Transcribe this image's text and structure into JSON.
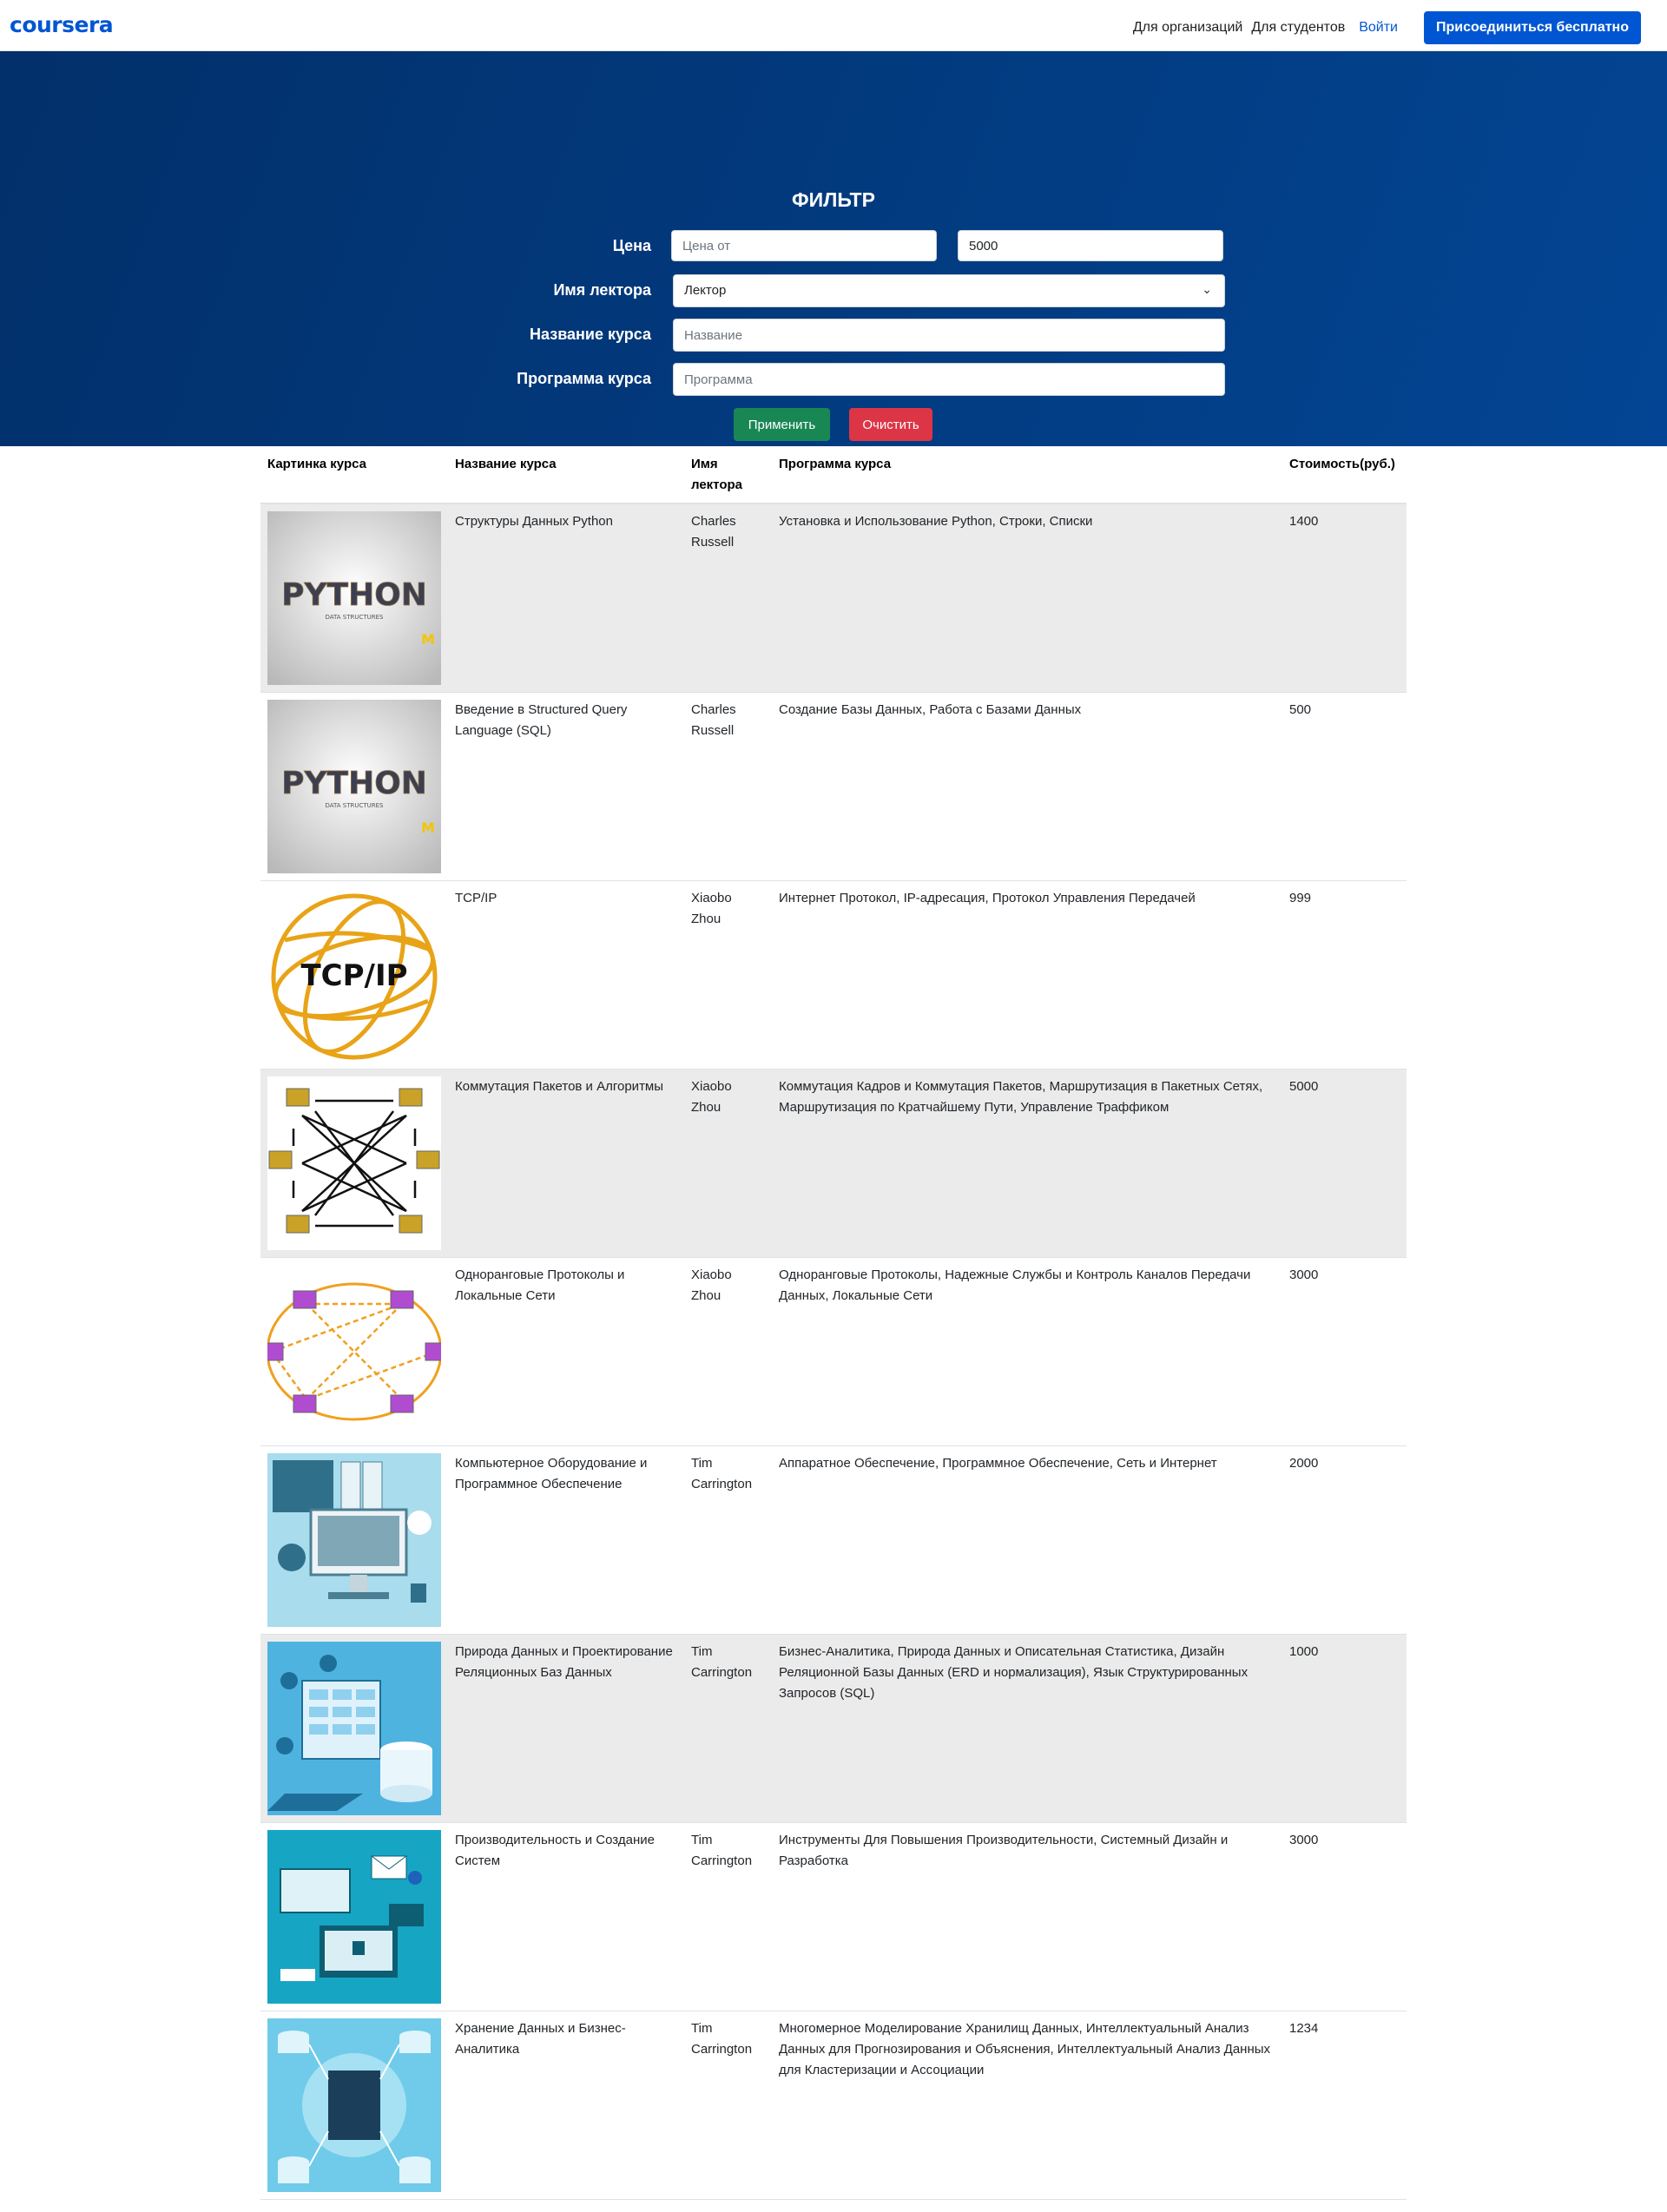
{
  "nav": {
    "logo": "coursera",
    "for_organizations": "Для организаций",
    "for_students": "Для студентов",
    "login": "Войти",
    "join": "Присоединиться бесплатно"
  },
  "filter": {
    "title": "ФИЛЬТР",
    "price_label": "Цена",
    "price_from_placeholder": "Цена от",
    "price_to_value": "5000",
    "lecturer_label": "Имя лектора",
    "lecturer_selected": "Лектор",
    "course_name_label": "Название курса",
    "course_name_placeholder": "Название",
    "program_label": "Программа курса",
    "program_placeholder": "Программа",
    "apply": "Применить",
    "clear": "Очистить"
  },
  "table": {
    "headers": {
      "image": "Картинка курса",
      "name": "Название курса",
      "lecturer": "Имя лектора",
      "program": "Программа курса",
      "price": "Стоимость(руб.)"
    },
    "rows": [
      {
        "image": "python-data-structures-image",
        "name": "Структуры Данных Python",
        "lecturer": "Charles Russell",
        "program": "Установка и Использование Python, Строки, Списки",
        "price": "1400"
      },
      {
        "image": "python-data-structures-image",
        "name": "Введение в Structured Query Language (SQL)",
        "lecturer": "Charles Russell",
        "program": "Создание Базы Данных, Работа с Базами Данных",
        "price": "500"
      },
      {
        "image": "tcp-ip-globe-image",
        "name": "TCP/IP",
        "lecturer": "Xiaobo Zhou",
        "program": "Интернет Протокол, IP-адресация, Протокол Управления Передачей",
        "price": "999"
      },
      {
        "image": "packet-switching-network-image",
        "name": "Коммутация Пакетов и Алгоритмы",
        "lecturer": "Xiaobo Zhou",
        "program": "Коммутация Кадров и Коммутация Пакетов, Маршрутизация в Пакетных Сетях, Маршрутизация по Кратчайшему Пути, Управление Траффиком",
        "price": "5000"
      },
      {
        "image": "p2p-network-image",
        "name": "Одноранговые Протоколы и Локальные Сети",
        "lecturer": "Xiaobo Zhou",
        "program": "Одноранговые Протоколы, Надежные Службы и Контроль Каналов Передачи Данных, Локальные Сети",
        "price": "3000"
      },
      {
        "image": "computer-hardware-image",
        "name": "Компьютерное Оборудование и Программное Обеспечение",
        "lecturer": "Tim Carrington",
        "program": "Аппаратное Обеспечение, Программное Обеспечение, Сеть и Интернет",
        "price": "2000"
      },
      {
        "image": "relational-database-image",
        "name": "Природа Данных и Проектирование Реляционных Баз Данных",
        "lecturer": "Tim Carrington",
        "program": "Бизнес-Аналитика, Природа Данных и Описательная Статистика, Дизайн Реляционной Базы Данных (ERD и нормализация), Язык Структурированных Запросов (SQL)",
        "price": "1000"
      },
      {
        "image": "system-productivity-image",
        "name": "Производительность и Создание Систем",
        "lecturer": "Tim Carrington",
        "program": "Инструменты Для Повышения Производительности, Системный Дизайн и Разработка",
        "price": "3000"
      },
      {
        "image": "data-warehouse-image",
        "name": "Хранение Данных и Бизнес-Аналитика",
        "lecturer": "Tim Carrington",
        "program": "Многомерное Моделирование Хранилищ Данных, Интеллектуальный Анализ Данных для Прогнозирования и Объяснения, Интеллектуальный Анализ Данных для Кластеризации и Ассоциации",
        "price": "1234"
      }
    ]
  },
  "colors": {
    "brand": "#0056d2",
    "hero_dark": "#02306a",
    "apply": "#198754",
    "clear": "#dc3545",
    "row_shade": "#ebebeb"
  }
}
